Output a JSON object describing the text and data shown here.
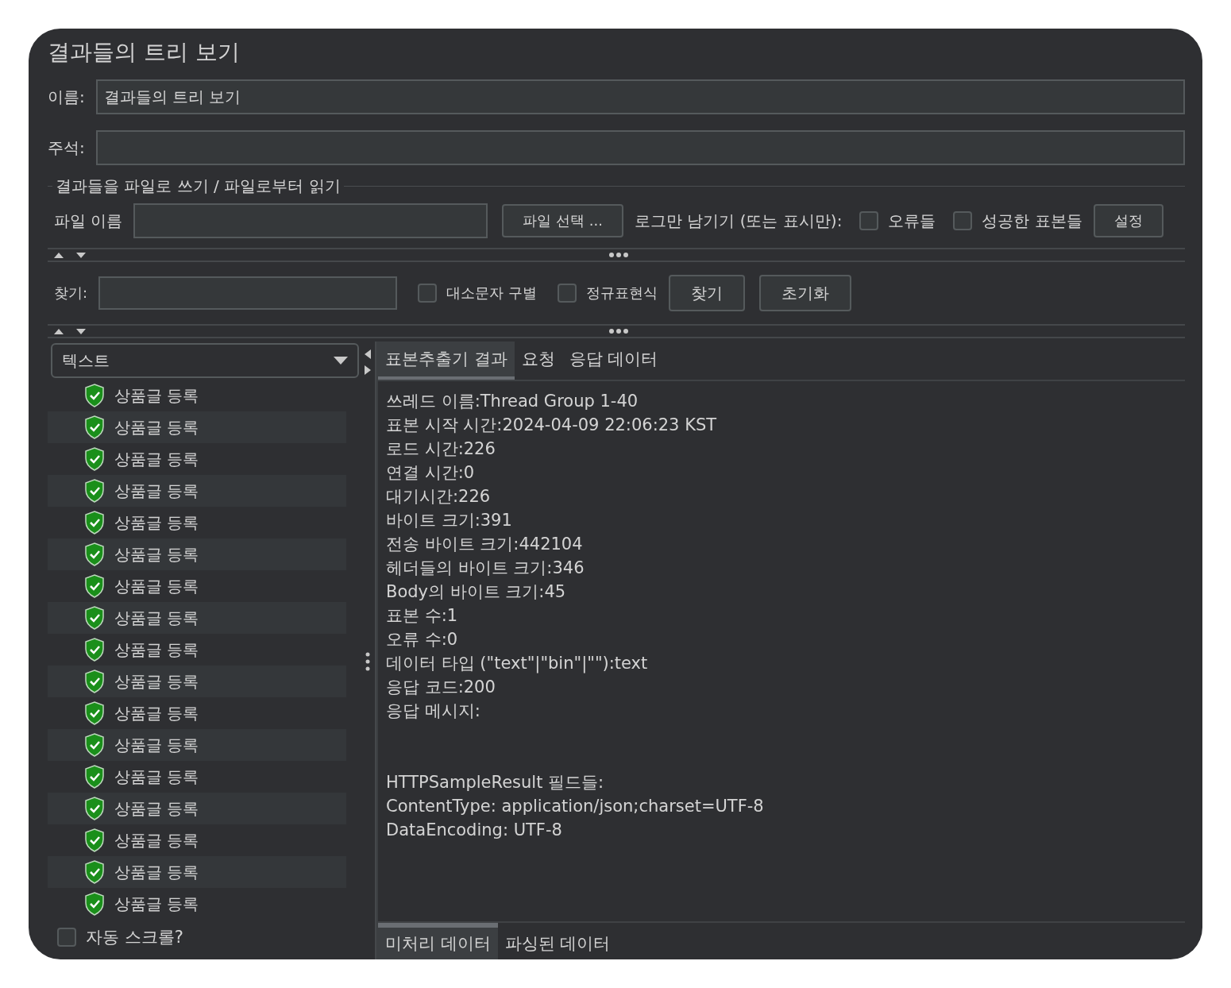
{
  "window": {
    "title": "결과들의 트리 보기"
  },
  "name_field": {
    "label": "이름:",
    "value": "결과들의 트리 보기"
  },
  "comment_field": {
    "label": "주석:"
  },
  "file_section": {
    "legend": "결과들을 파일로 쓰기 / 파일로부터 읽기",
    "file_label": "파일 이름",
    "browse_button": "파일 선택 ...",
    "log_label": "로그만 남기기 (또는 표시만):",
    "checkboxes": [
      {
        "label": "오류들",
        "checked": false
      },
      {
        "label": "성공한 표본들",
        "checked": false
      }
    ],
    "settings_button": "설정"
  },
  "search": {
    "label": "찾기:",
    "options": [
      {
        "label": "대소문자 구별",
        "checked": false
      },
      {
        "label": "정규표현식",
        "checked": false
      }
    ],
    "buttons": [
      "찾기",
      "초기화"
    ]
  },
  "renderer_select": {
    "value": "텍스트"
  },
  "tree": {
    "items": [
      {
        "label": "상품글 등록",
        "kind": "success"
      },
      {
        "label": "상품글 등록",
        "kind": "success"
      },
      {
        "label": "상품글 등록",
        "kind": "success"
      },
      {
        "label": "상품글 등록",
        "kind": "success"
      },
      {
        "label": "상품글 등록",
        "kind": "success"
      },
      {
        "label": "상품글 등록",
        "kind": "success"
      },
      {
        "label": "상품글 등록",
        "kind": "success"
      },
      {
        "label": "상품글 등록",
        "kind": "success"
      },
      {
        "label": "상품글 등록",
        "kind": "success"
      },
      {
        "label": "상품글 등록",
        "kind": "success"
      },
      {
        "label": "상품글 등록",
        "kind": "success"
      },
      {
        "label": "상품글 등록",
        "kind": "success"
      },
      {
        "label": "상품글 등록",
        "kind": "success"
      },
      {
        "label": "상품글 등록",
        "kind": "success"
      },
      {
        "label": "상품글 등록",
        "kind": "success"
      },
      {
        "label": "상품글 등록",
        "kind": "success"
      },
      {
        "label": "상품글 등록",
        "kind": "success"
      }
    ]
  },
  "auto_scroll": {
    "label": "자동 스크롤?",
    "checked": false
  },
  "tabs": [
    {
      "label": "표본추출기 결과",
      "selected": true
    },
    {
      "label": "요청",
      "selected": false
    },
    {
      "label": "응답 데이터",
      "selected": false
    }
  ],
  "result_blocks": [
    [
      "쓰레드 이름:Thread Group 1-40",
      "표본 시작 시간:2024-04-09 22:06:23 KST",
      "로드 시간:226",
      "연결 시간:0",
      "대기시간:226",
      "바이트 크기:391",
      "전송 바이트 크기:442104",
      "헤더들의 바이트 크기:346",
      "Body의 바이트 크기:45",
      "표본 수:1",
      "오류 수:0",
      "데이터 타입 (\"text\"|\"bin\"|\"\"):text",
      "응답 코드:200",
      "응답 메시지:"
    ],
    [
      "HTTPSampleResult 필드들:",
      "ContentType: application/json;charset=UTF-8",
      "DataEncoding: UTF-8"
    ]
  ],
  "bottom_tabs": [
    {
      "label": "미처리 데이터",
      "selected": true
    },
    {
      "label": "파싱된 데이터",
      "selected": false
    }
  ]
}
